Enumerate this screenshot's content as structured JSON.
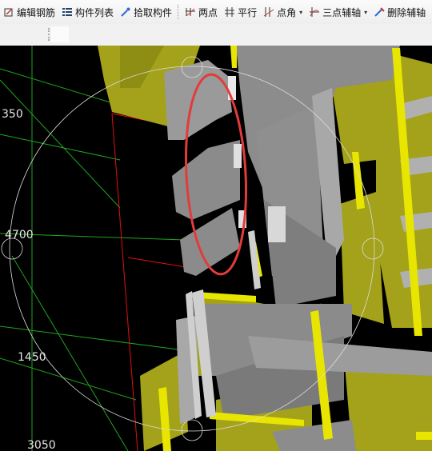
{
  "toolbar": {
    "items": [
      {
        "label": "编辑钢筋",
        "icon": "edit-rebar-icon"
      },
      {
        "label": "构件列表",
        "icon": "component-list-icon"
      },
      {
        "label": "拾取构件",
        "icon": "pick-component-icon"
      },
      {
        "label": "两点",
        "icon": "two-point-axis-icon"
      },
      {
        "label": "平行",
        "icon": "parallel-axis-icon"
      },
      {
        "label": "点角",
        "icon": "point-angle-axis-icon"
      },
      {
        "label": "三点辅轴",
        "icon": "three-point-axis-icon"
      },
      {
        "label": "删除辅轴",
        "icon": "delete-axis-icon"
      }
    ]
  },
  "viewport": {
    "dimensions": [
      "350",
      "4700",
      "1450",
      "3050"
    ]
  },
  "colors": {
    "toolbar_bg": "#f0f0f0",
    "viewport_bg": "#000000",
    "grid_line": "#1fa51f",
    "axis_line": "#e01010",
    "component_yellow": "#a3a21a",
    "component_bright_yellow": "#e8e600",
    "component_gray": "#8c8c8c",
    "highlight_ellipse": "#e23b3b"
  }
}
